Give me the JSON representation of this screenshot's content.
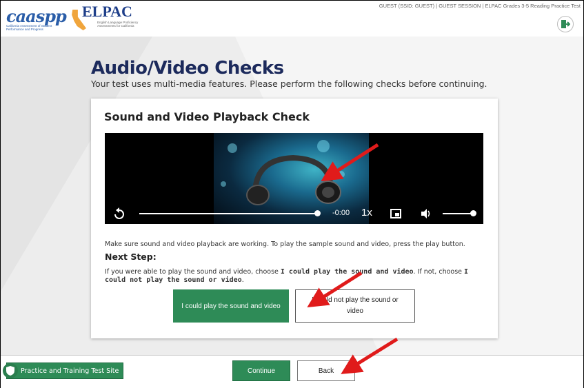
{
  "header": {
    "caaspp_logo": {
      "word": "caaspp",
      "subtitle": "California Assessment of Student Performance and Progress"
    },
    "elpac_logo": {
      "word": "ELPAC",
      "subtitle": "English Language Proficiency Assessments for California"
    },
    "session_info": "GUEST (SSID: GUEST) | GUEST SESSION | ELPAC Grades 3-5 Reading Practice Test",
    "logout_icon": "logout-icon"
  },
  "main": {
    "title": "Audio/Video Checks",
    "subtitle": "Your test uses multi-media features. Please perform the following checks before continuing."
  },
  "card": {
    "title": "Sound and Video Playback Check",
    "player": {
      "time": "-0:00",
      "speed": "1x",
      "progress": 1.0,
      "volume": 1.0,
      "icons": [
        "replay-icon",
        "pip-icon",
        "volume-icon"
      ]
    },
    "instruction": "Make sure sound and video playback are working. To play the sample sound and video, press the play button.",
    "next_step_label": "Next Step:",
    "next_step": {
      "part1": "If you were able to play the sound and video, choose ",
      "bold1": "I could play the sound and video",
      "part2": ". If not, choose ",
      "bold2": "I could not play the sound or video",
      "part3": "."
    },
    "could_play_label": "I could play the sound and video",
    "could_not_play_label": "I could not play the sound or video"
  },
  "footer": {
    "practice_badge": "Practice and Training Test Site",
    "continue_label": "Continue",
    "back_label": "Back"
  },
  "colors": {
    "title": "#1c2a5c",
    "primary_green": "#2e8b57",
    "annotation_arrow": "#e01b1b"
  }
}
